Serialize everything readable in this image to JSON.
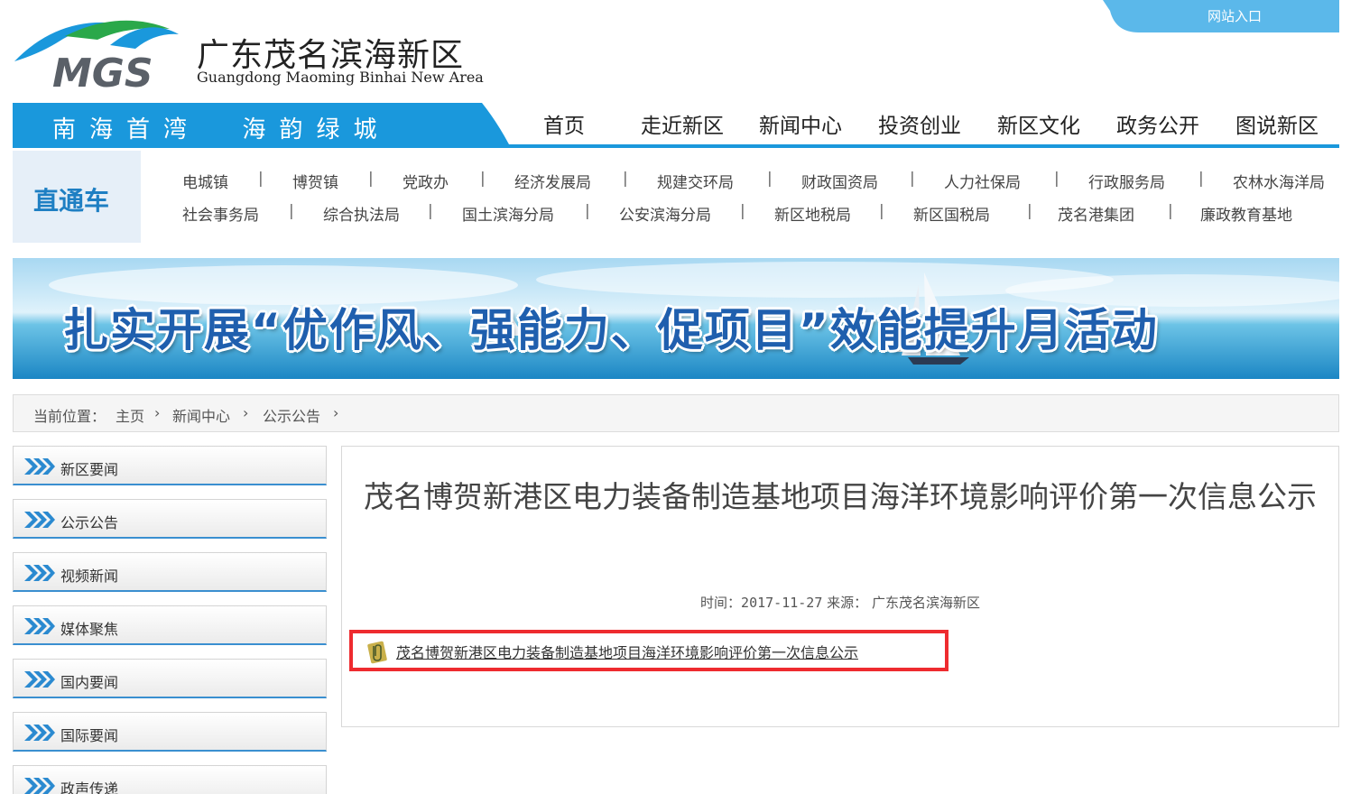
{
  "header": {
    "logo_text": "MGS",
    "site_name": "广东茂名滨海新区",
    "site_name_en": "Guangdong Maoming Binhai New Area",
    "portal_label": "网站入口"
  },
  "nav": {
    "slogan": "南海首湾  海韵绿城",
    "items": [
      "首页",
      "走近新区",
      "新闻中心",
      "投资创业",
      "新区文化",
      "政务公开",
      "图说新区"
    ]
  },
  "direct": {
    "title": "直通车",
    "row1": [
      "电城镇",
      "博贺镇",
      "党政办",
      "经济发展局",
      "规建交环局",
      "财政国资局",
      "人力社保局",
      "行政服务局",
      "农林水海洋局"
    ],
    "row2": [
      "社会事务局",
      "综合执法局",
      "国土滨海分局",
      "公安滨海分局",
      "新区地税局",
      "新区国税局",
      "茂名港集团",
      "廉政教育基地"
    ]
  },
  "banner": {
    "text": "扎实开展“优作风、强能力、促项目”效能提升月活动"
  },
  "breadcrumb": {
    "label": "当前位置：",
    "items": [
      "主页",
      "新闻中心",
      "公示公告"
    ]
  },
  "sidebar": {
    "items": [
      "新区要闻",
      "公示公告",
      "视频新闻",
      "媒体聚焦",
      "国内要闻",
      "国际要闻",
      "政声传递"
    ]
  },
  "article": {
    "title": "茂名博贺新港区电力装备制造基地项目海洋环境影响评价第一次信息公示",
    "time_label": "时间：",
    "date": "2017-11-27",
    "source_label": "来源：",
    "source": "广东茂名滨海新区",
    "attachment": "茂名博贺新港区电力装备制造基地项目海洋环境影响评价第一次信息公示"
  },
  "colors": {
    "accent": "#1a98dc",
    "highlight_box": "#ee2b2f",
    "direct_title": "#1e7fc3"
  }
}
